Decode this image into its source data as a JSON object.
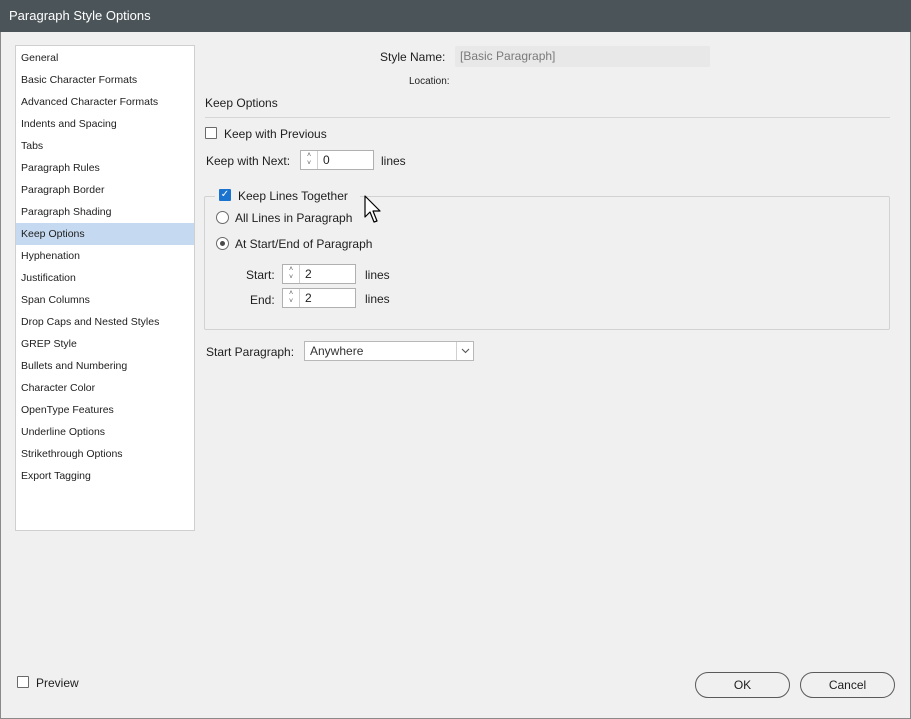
{
  "window": {
    "title": "Paragraph Style Options"
  },
  "sidebar": {
    "items": [
      {
        "label": "General"
      },
      {
        "label": "Basic Character Formats"
      },
      {
        "label": "Advanced Character Formats"
      },
      {
        "label": "Indents and Spacing"
      },
      {
        "label": "Tabs"
      },
      {
        "label": "Paragraph Rules"
      },
      {
        "label": "Paragraph Border"
      },
      {
        "label": "Paragraph Shading"
      },
      {
        "label": "Keep Options",
        "selected": true
      },
      {
        "label": "Hyphenation"
      },
      {
        "label": "Justification"
      },
      {
        "label": "Span Columns"
      },
      {
        "label": "Drop Caps and Nested Styles"
      },
      {
        "label": "GREP Style"
      },
      {
        "label": "Bullets and Numbering"
      },
      {
        "label": "Character Color"
      },
      {
        "label": "OpenType Features"
      },
      {
        "label": "Underline Options"
      },
      {
        "label": "Strikethrough Options"
      },
      {
        "label": "Export Tagging"
      }
    ]
  },
  "header": {
    "style_name_label": "Style Name:",
    "style_name_value": "[Basic Paragraph]",
    "location_label": "Location:"
  },
  "section": {
    "title": "Keep Options"
  },
  "keep_with_previous": {
    "label": "Keep with Previous",
    "checked": false
  },
  "keep_with_next": {
    "label": "Keep with Next:",
    "value": "0",
    "unit": "lines"
  },
  "keep_lines_together": {
    "label": "Keep Lines Together",
    "checked": true,
    "all_lines": {
      "label": "All Lines in Paragraph",
      "selected": false
    },
    "start_end": {
      "label": "At Start/End of Paragraph",
      "selected": true
    },
    "start": {
      "label": "Start:",
      "value": "2",
      "unit": "lines"
    },
    "end": {
      "label": "End:",
      "value": "2",
      "unit": "lines"
    }
  },
  "start_paragraph": {
    "label": "Start Paragraph:",
    "value": "Anywhere"
  },
  "footer": {
    "preview_label": "Preview",
    "preview_checked": false,
    "ok_label": "OK",
    "cancel_label": "Cancel"
  },
  "colors": {
    "titlebar": "#4b5458",
    "selection": "#c5d9f0",
    "checkbox_accent": "#1b73d0",
    "dialog_bg": "#f0f0f0"
  }
}
